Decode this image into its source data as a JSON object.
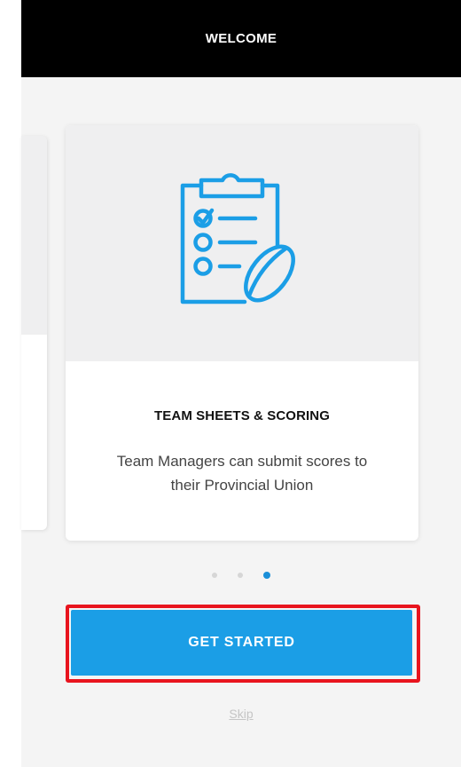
{
  "header": {
    "title": "WELCOME"
  },
  "carousel": {
    "current_slide": {
      "icon": "clipboard-checklist-rugby-ball-icon",
      "title": "TEAM SHEETS & SCORING",
      "description": "Team Managers can submit scores to their Provincial Union"
    },
    "total_slides": 3,
    "active_index": 2
  },
  "actions": {
    "get_started_label": "GET STARTED",
    "skip_label": "Skip"
  },
  "colors": {
    "header_bg": "#000000",
    "accent": "#1b9ee6",
    "highlight_border": "#e8141e",
    "dot_active": "#1a8fd8",
    "dot_inactive": "#d6d6d6"
  }
}
